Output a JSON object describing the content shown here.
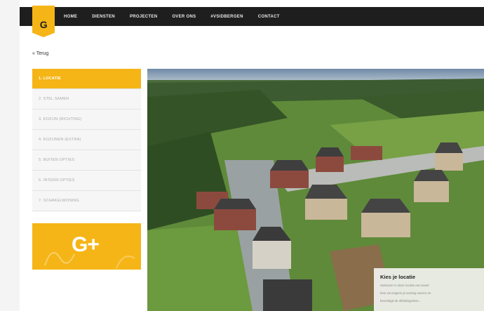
{
  "logo": {
    "text": "G",
    "accent": "#f5b517"
  },
  "nav": {
    "items": [
      "HOME",
      "DIENSTEN",
      "PROJECTEN",
      "OVER ONS",
      "#VSIDBERGEN",
      "CONTACT"
    ]
  },
  "back_link": "« Terug",
  "steps": [
    "1. LOCATIE",
    "2. STEL SAMEN",
    "3. KOZIJN (RICHTING)",
    "4. KOZIJNEN (EXTRA)",
    "5. BUITEN OPTIES",
    "6. INTERN OPTIES",
    "7. SCHAKELWONING"
  ],
  "active_step": 0,
  "promo": {
    "text": "G+"
  },
  "overlay": {
    "title": "Kies je locatie",
    "lines": [
      "Selecteer in deze locatie een kavel",
      "Dan vervolgens je woning samen en",
      "bevestigd de afleidingsriten..."
    ]
  },
  "colors": {
    "accent": "#f5b517",
    "topbar": "#1e1e1e",
    "grass": "#5f8a3a"
  }
}
